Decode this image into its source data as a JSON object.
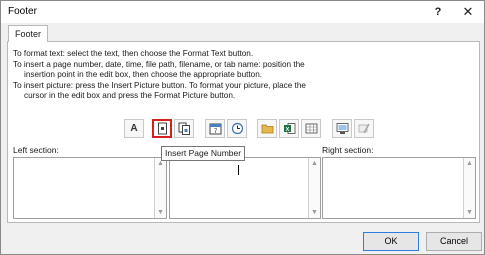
{
  "window": {
    "title": "Footer",
    "help_label": "?",
    "close_label": "✕"
  },
  "tab": {
    "label": "Footer"
  },
  "instructions": [
    "To format text:  select the text, then choose the Format Text button.",
    "To insert a page number, date, time, file path, filename, or tab name:  position the",
    "insertion point in the edit box, then choose the appropriate button.",
    "To insert picture: press the Insert Picture button.  To format your picture, place the",
    "cursor in the edit box and press the Format Picture button."
  ],
  "toolbar": {
    "format_text_glyph": "A",
    "active_button": "insert-page-number",
    "tooltip": "Insert Page Number"
  },
  "sections": {
    "left_label": "Left section:",
    "center_label": "",
    "right_label": "Right section:"
  },
  "buttons": {
    "ok": "OK",
    "cancel": "Cancel"
  },
  "colors": {
    "active_border": "#d62020",
    "ok_border": "#2c7de0",
    "excel_green": "#1e7145"
  }
}
